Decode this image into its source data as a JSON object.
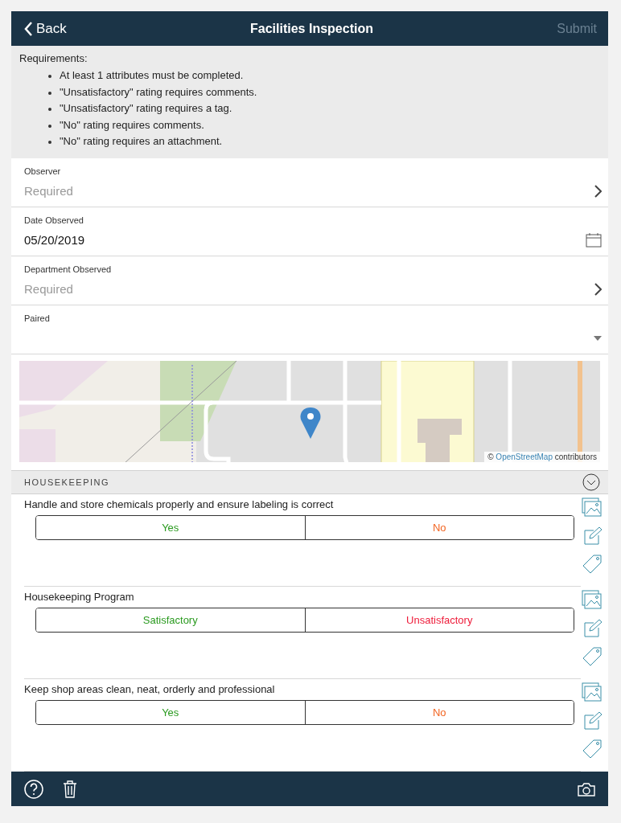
{
  "header": {
    "back": "Back",
    "title": "Facilities Inspection",
    "submit": "Submit",
    "submit_disabled": true
  },
  "requirements": {
    "heading": "Requirements:",
    "items": [
      "At least 1 attributes must be completed.",
      "\"Unsatisfactory\" rating requires comments.",
      "\"Unsatisfactory\" rating requires a tag.",
      "\"No\" rating requires comments.",
      "\"No\" rating requires an attachment."
    ]
  },
  "fields": [
    {
      "kind": "picker",
      "label": "Observer",
      "placeholder": "Required"
    },
    {
      "kind": "date",
      "label": "Date Observed",
      "value": "05/20/2019"
    },
    {
      "kind": "picker",
      "label": "Department Observed",
      "placeholder": "Required"
    },
    {
      "kind": "dropdown",
      "label": "Paired"
    }
  ],
  "map": {
    "attribution_prefix": "©",
    "attribution_link": "OpenStreetMap",
    "attribution_suffix": "contributors"
  },
  "section": {
    "title": "HOUSEKEEPING",
    "expanded": true
  },
  "questions": [
    {
      "text": "Handle and store chemicals properly and ensure labeling is correct",
      "options": [
        {
          "label": "Yes",
          "color": "#2a9a1f",
          "selected": false
        },
        {
          "label": "No",
          "color": "#f26522",
          "selected": false
        }
      ]
    },
    {
      "text": "Housekeeping Program",
      "options": [
        {
          "label": "Satisfactory",
          "color": "#2a9a1f",
          "selected": false
        },
        {
          "label": "Unsatisfactory",
          "color": "#ee1c3a",
          "selected": false
        }
      ]
    },
    {
      "text": "Keep shop areas clean, neat, orderly and professional",
      "options": [
        {
          "label": "Yes",
          "color": "#2a9a1f",
          "selected": false
        },
        {
          "label": "No",
          "color": "#f26522",
          "selected": false
        }
      ]
    }
  ]
}
